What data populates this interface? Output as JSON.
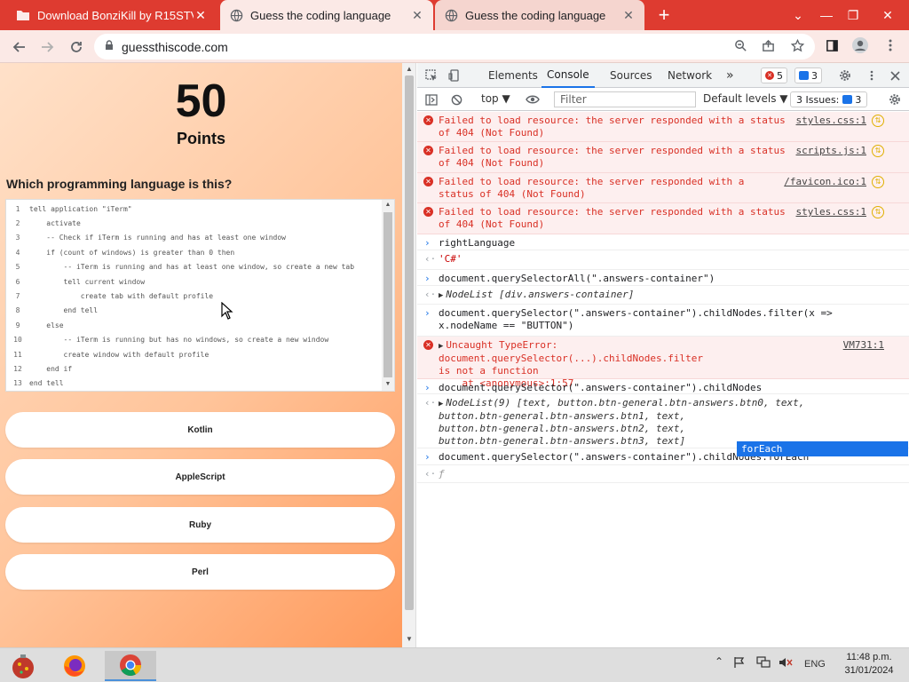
{
  "browser": {
    "tabs": [
      {
        "title": "Download BonziKill by R15STV ·",
        "active": false
      },
      {
        "title": "Guess the coding language",
        "active": true
      },
      {
        "title": "Guess the coding language",
        "active": false
      }
    ],
    "close_glyph": "✕",
    "new_tab_glyph": "+",
    "url": "guessthiscode.com",
    "window_controls": [
      "⌄",
      "—",
      "❐",
      "✕"
    ]
  },
  "page": {
    "points_value": "50",
    "points_label": "Points",
    "question": "Which programming language is this?",
    "code_lines": [
      {
        "n": "1",
        "text": "tell application \"iTerm\""
      },
      {
        "n": "2",
        "text": "    activate"
      },
      {
        "n": "3",
        "text": "    -- Check if iTerm is running and has at least one window"
      },
      {
        "n": "4",
        "text": "    if (count of windows) is greater than 0 then"
      },
      {
        "n": "5",
        "text": "        -- iTerm is running and has at least one window, so create a new tab"
      },
      {
        "n": "6",
        "text": "        tell current window"
      },
      {
        "n": "7",
        "text": "            create tab with default profile"
      },
      {
        "n": "8",
        "text": "        end tell"
      },
      {
        "n": "9",
        "text": "    else"
      },
      {
        "n": "10",
        "text": "        -- iTerm is running but has no windows, so create a new window"
      },
      {
        "n": "11",
        "text": "        create window with default profile"
      },
      {
        "n": "12",
        "text": "    end if"
      },
      {
        "n": "13",
        "text": "end tell"
      }
    ],
    "answers": [
      "Kotlin",
      "AppleScript",
      "Ruby",
      "Perl"
    ]
  },
  "devtools": {
    "tabs": [
      "Elements",
      "Console",
      "Sources",
      "Network"
    ],
    "active_tab": "Console",
    "more_glyph": "»",
    "error_count": "5",
    "info_count": "3",
    "context": "top ▼",
    "filter_placeholder": "Filter",
    "levels": "Default levels ▼",
    "issues_label": "3 Issues:",
    "issues_count": "3",
    "console": [
      {
        "kind": "error",
        "msg": "Failed to load resource: the server responded with a status\nof 404 (Not Found)",
        "src": "styles.css:1"
      },
      {
        "kind": "error",
        "msg": "Failed to load resource: the server responded with a status\nof 404 (Not Found)",
        "src": "scripts.js:1"
      },
      {
        "kind": "error",
        "msg": "Failed to load resource: the server responded with a\nstatus of 404 (Not Found)",
        "src": "/favicon.ico:1"
      },
      {
        "kind": "error",
        "msg": "Failed to load resource: the server responded with a status\nof 404 (Not Found)",
        "src": "styles.css:1"
      },
      {
        "kind": "input",
        "text": "rightLanguage"
      },
      {
        "kind": "output",
        "text": "'C#'"
      },
      {
        "kind": "input",
        "text": "document.querySelectorAll(\".answers-container\")"
      },
      {
        "kind": "output",
        "text": "NodeList [div.answers-container]"
      },
      {
        "kind": "input",
        "text": "document.querySelector(\".answers-container\").childNodes.filter(x =>\nx.nodeName == \"BUTTON\")"
      },
      {
        "kind": "error2",
        "msg": "Uncaught TypeError: document.querySelector(...).childNodes.filter\nis not a function\n    at <anonymous>:1:57",
        "src": "VM731:1"
      },
      {
        "kind": "input",
        "text": "document.querySelector(\".answers-container\").childNodes"
      },
      {
        "kind": "output",
        "text": "NodeList(9) [text, button.btn-general.btn-answers.btn0, text,\nbutton.btn-general.btn-answers.btn1, text,\nbutton.btn-general.btn-answers.btn2, text,\nbutton.btn-general.btn-answers.btn3, text]"
      },
      {
        "kind": "input",
        "text": "document.querySelector(\".answers-container\").childNodes.forEach"
      },
      {
        "kind": "output",
        "text": "ƒ"
      }
    ],
    "autocomplete": "forEach"
  },
  "taskbar": {
    "language": "ENG",
    "time": "11:48 p.m.",
    "date": "31/01/2024"
  },
  "colors": {
    "tabstrip": "#de3b30",
    "accent": "#1a73e8",
    "error": "#d93025"
  }
}
